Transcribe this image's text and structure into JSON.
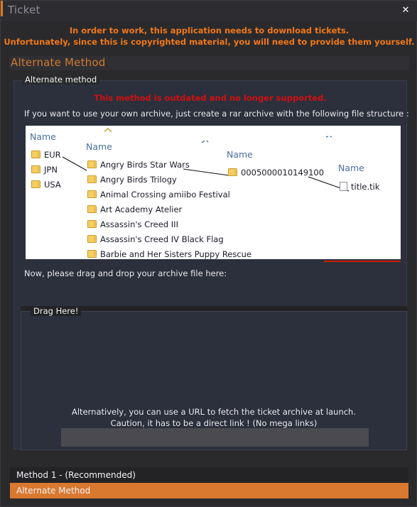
{
  "window": {
    "title": "Ticket",
    "close_label": "✕",
    "accent_color": "#e07b2c"
  },
  "notice": {
    "line1": "In order to work, this application needs to download tickets.",
    "line2": "Unfortunately, since this is copyrighted material, you will need to provide them yourself.",
    "color": "#f07818"
  },
  "page": {
    "heading": "Alternate Method"
  },
  "groupbox": {
    "label": "Alternate method",
    "warning": "This method is outdated and no longer supported.",
    "warning_color": "#d01010",
    "instruction": "If you want to use your own archive, just create a rar archive with the following file structure :"
  },
  "diagram": {
    "columns": [
      {
        "header": "Name",
        "items": [
          "EUR",
          "JPN",
          "USA"
        ],
        "kind": "folder"
      },
      {
        "header": "Name",
        "items": [
          "Angry Birds Star Wars",
          "Angry Birds Trilogy",
          "Animal Crossing amiibo Festival",
          "Art Academy Atelier",
          "Assassin's Creed III",
          "Assassin's Creed IV Black Flag",
          "Barbie and Her Sisters Puppy Rescue"
        ],
        "kind": "folder"
      },
      {
        "header": "Name",
        "items": [
          "0005000010149100"
        ],
        "kind": "folder"
      },
      {
        "header": "Name",
        "items": [
          "title.tik"
        ],
        "kind": "file"
      }
    ]
  },
  "drop": {
    "prompt": "Now, please drag and drop your archive file here:",
    "box_label": "Drag Here!"
  },
  "url": {
    "line1": "Alternatively, you can use a URL to fetch the ticket archive at launch.",
    "line2": "Caution, it has to be a direct link ! (No mega links)",
    "value": "",
    "placeholder": ""
  },
  "tabs": [
    {
      "label": "Method 1 - (Recommended)",
      "selected": false
    },
    {
      "label": "Alternate Method",
      "selected": true
    }
  ]
}
